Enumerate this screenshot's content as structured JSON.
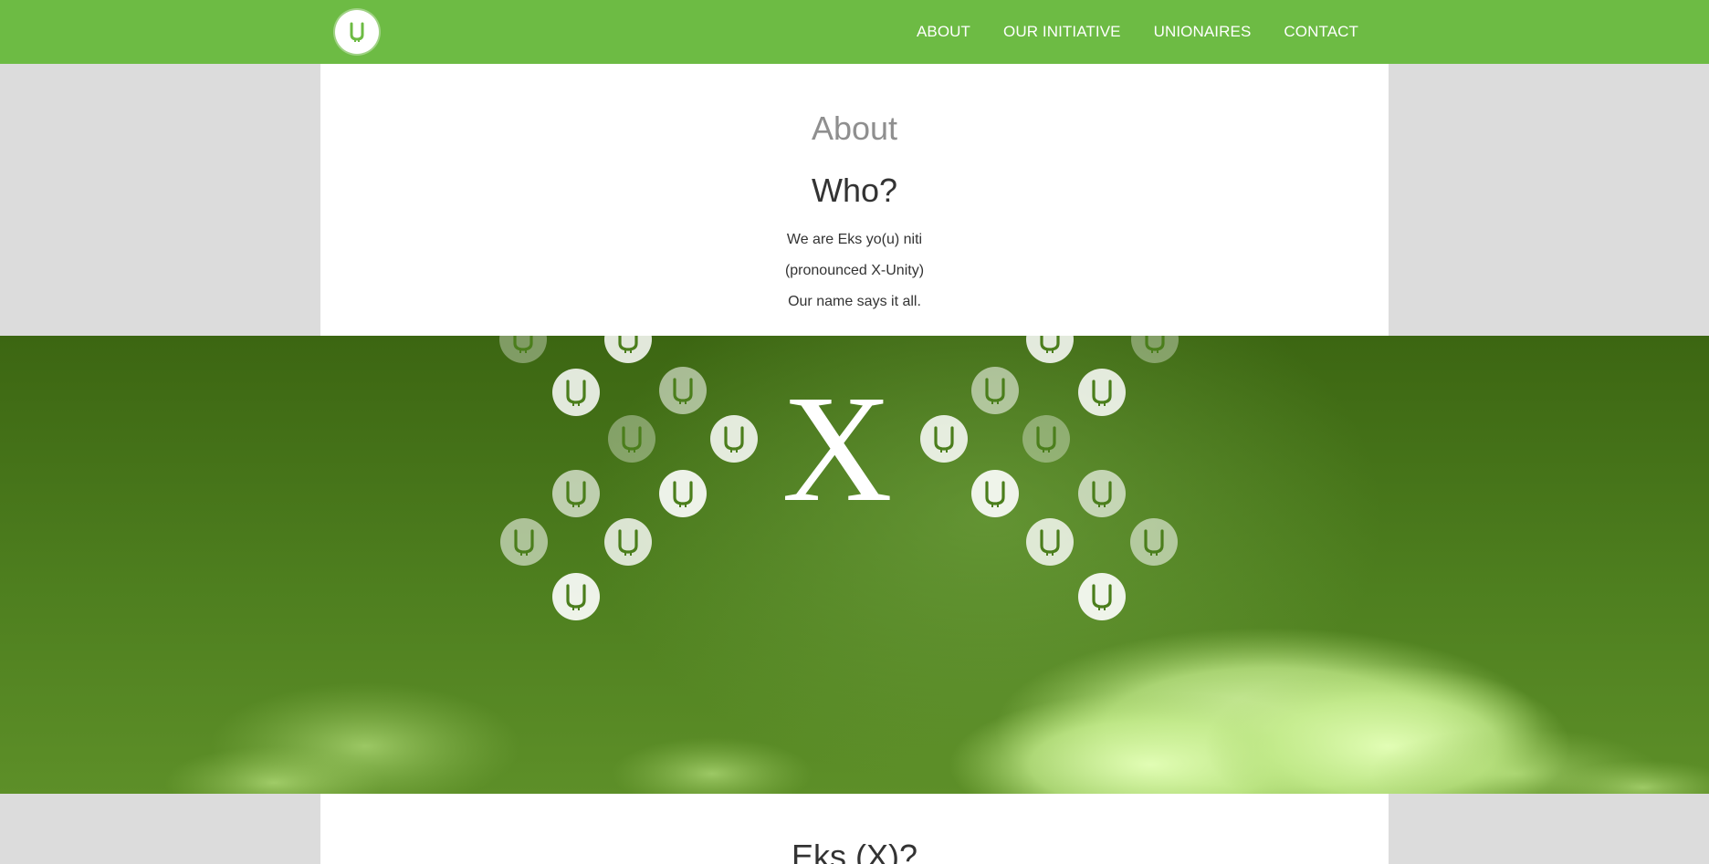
{
  "nav": {
    "logo_icon": "u-logo-icon",
    "links": [
      "ABOUT",
      "OUR INITIATIVE",
      "UNIONAIRES",
      "CONTACT"
    ]
  },
  "about": {
    "section_title": "About",
    "heading": "Who?",
    "lines": [
      "We are Eks yo(u) niti",
      "(pronounced X-Unity)",
      "Our name says it all."
    ]
  },
  "hero": {
    "center_letter": "X",
    "badge_icon": "u-badge-icon"
  },
  "eks": {
    "heading": "Eks (X)?"
  },
  "colors": {
    "nav_green": "#6dbb44",
    "hero_green": "#4e7f1f",
    "page_gray": "#dcdcdc",
    "title_gray": "#8f8f8f",
    "text_dark": "#333333"
  }
}
